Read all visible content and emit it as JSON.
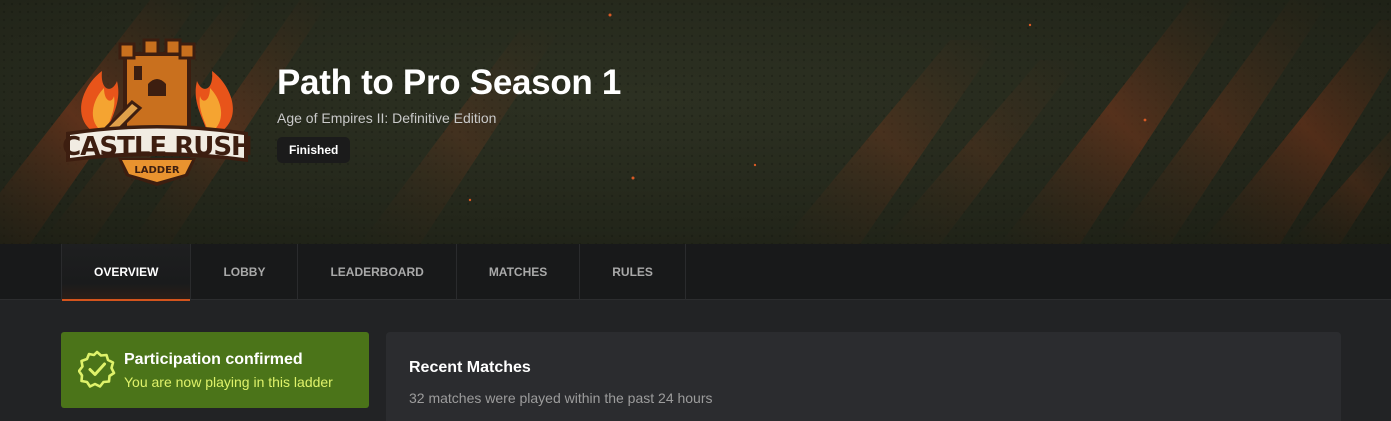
{
  "header": {
    "logo_text": "CASTLE RUSH",
    "logo_subtext": "LADDER",
    "title": "Path to Pro Season 1",
    "game": "Age of Empires II: Definitive Edition",
    "status": "Finished"
  },
  "nav": {
    "tabs": [
      {
        "label": "OVERVIEW",
        "active": true
      },
      {
        "label": "LOBBY",
        "active": false
      },
      {
        "label": "LEADERBOARD",
        "active": false
      },
      {
        "label": "MATCHES",
        "active": false
      },
      {
        "label": "RULES",
        "active": false
      }
    ]
  },
  "participation": {
    "icon": "badge-check-icon",
    "title": "Participation confirmed",
    "subtitle": "You are now playing in this ladder"
  },
  "recent_matches": {
    "title": "Recent Matches",
    "subtitle": "32 matches were played within the past 24 hours"
  },
  "colors": {
    "accent": "#d4541d",
    "success_bg": "#4b7419",
    "success_text": "#dff26a",
    "nav_bg": "#18191a",
    "page_bg": "#222325",
    "card_bg": "#2b2c2f"
  }
}
